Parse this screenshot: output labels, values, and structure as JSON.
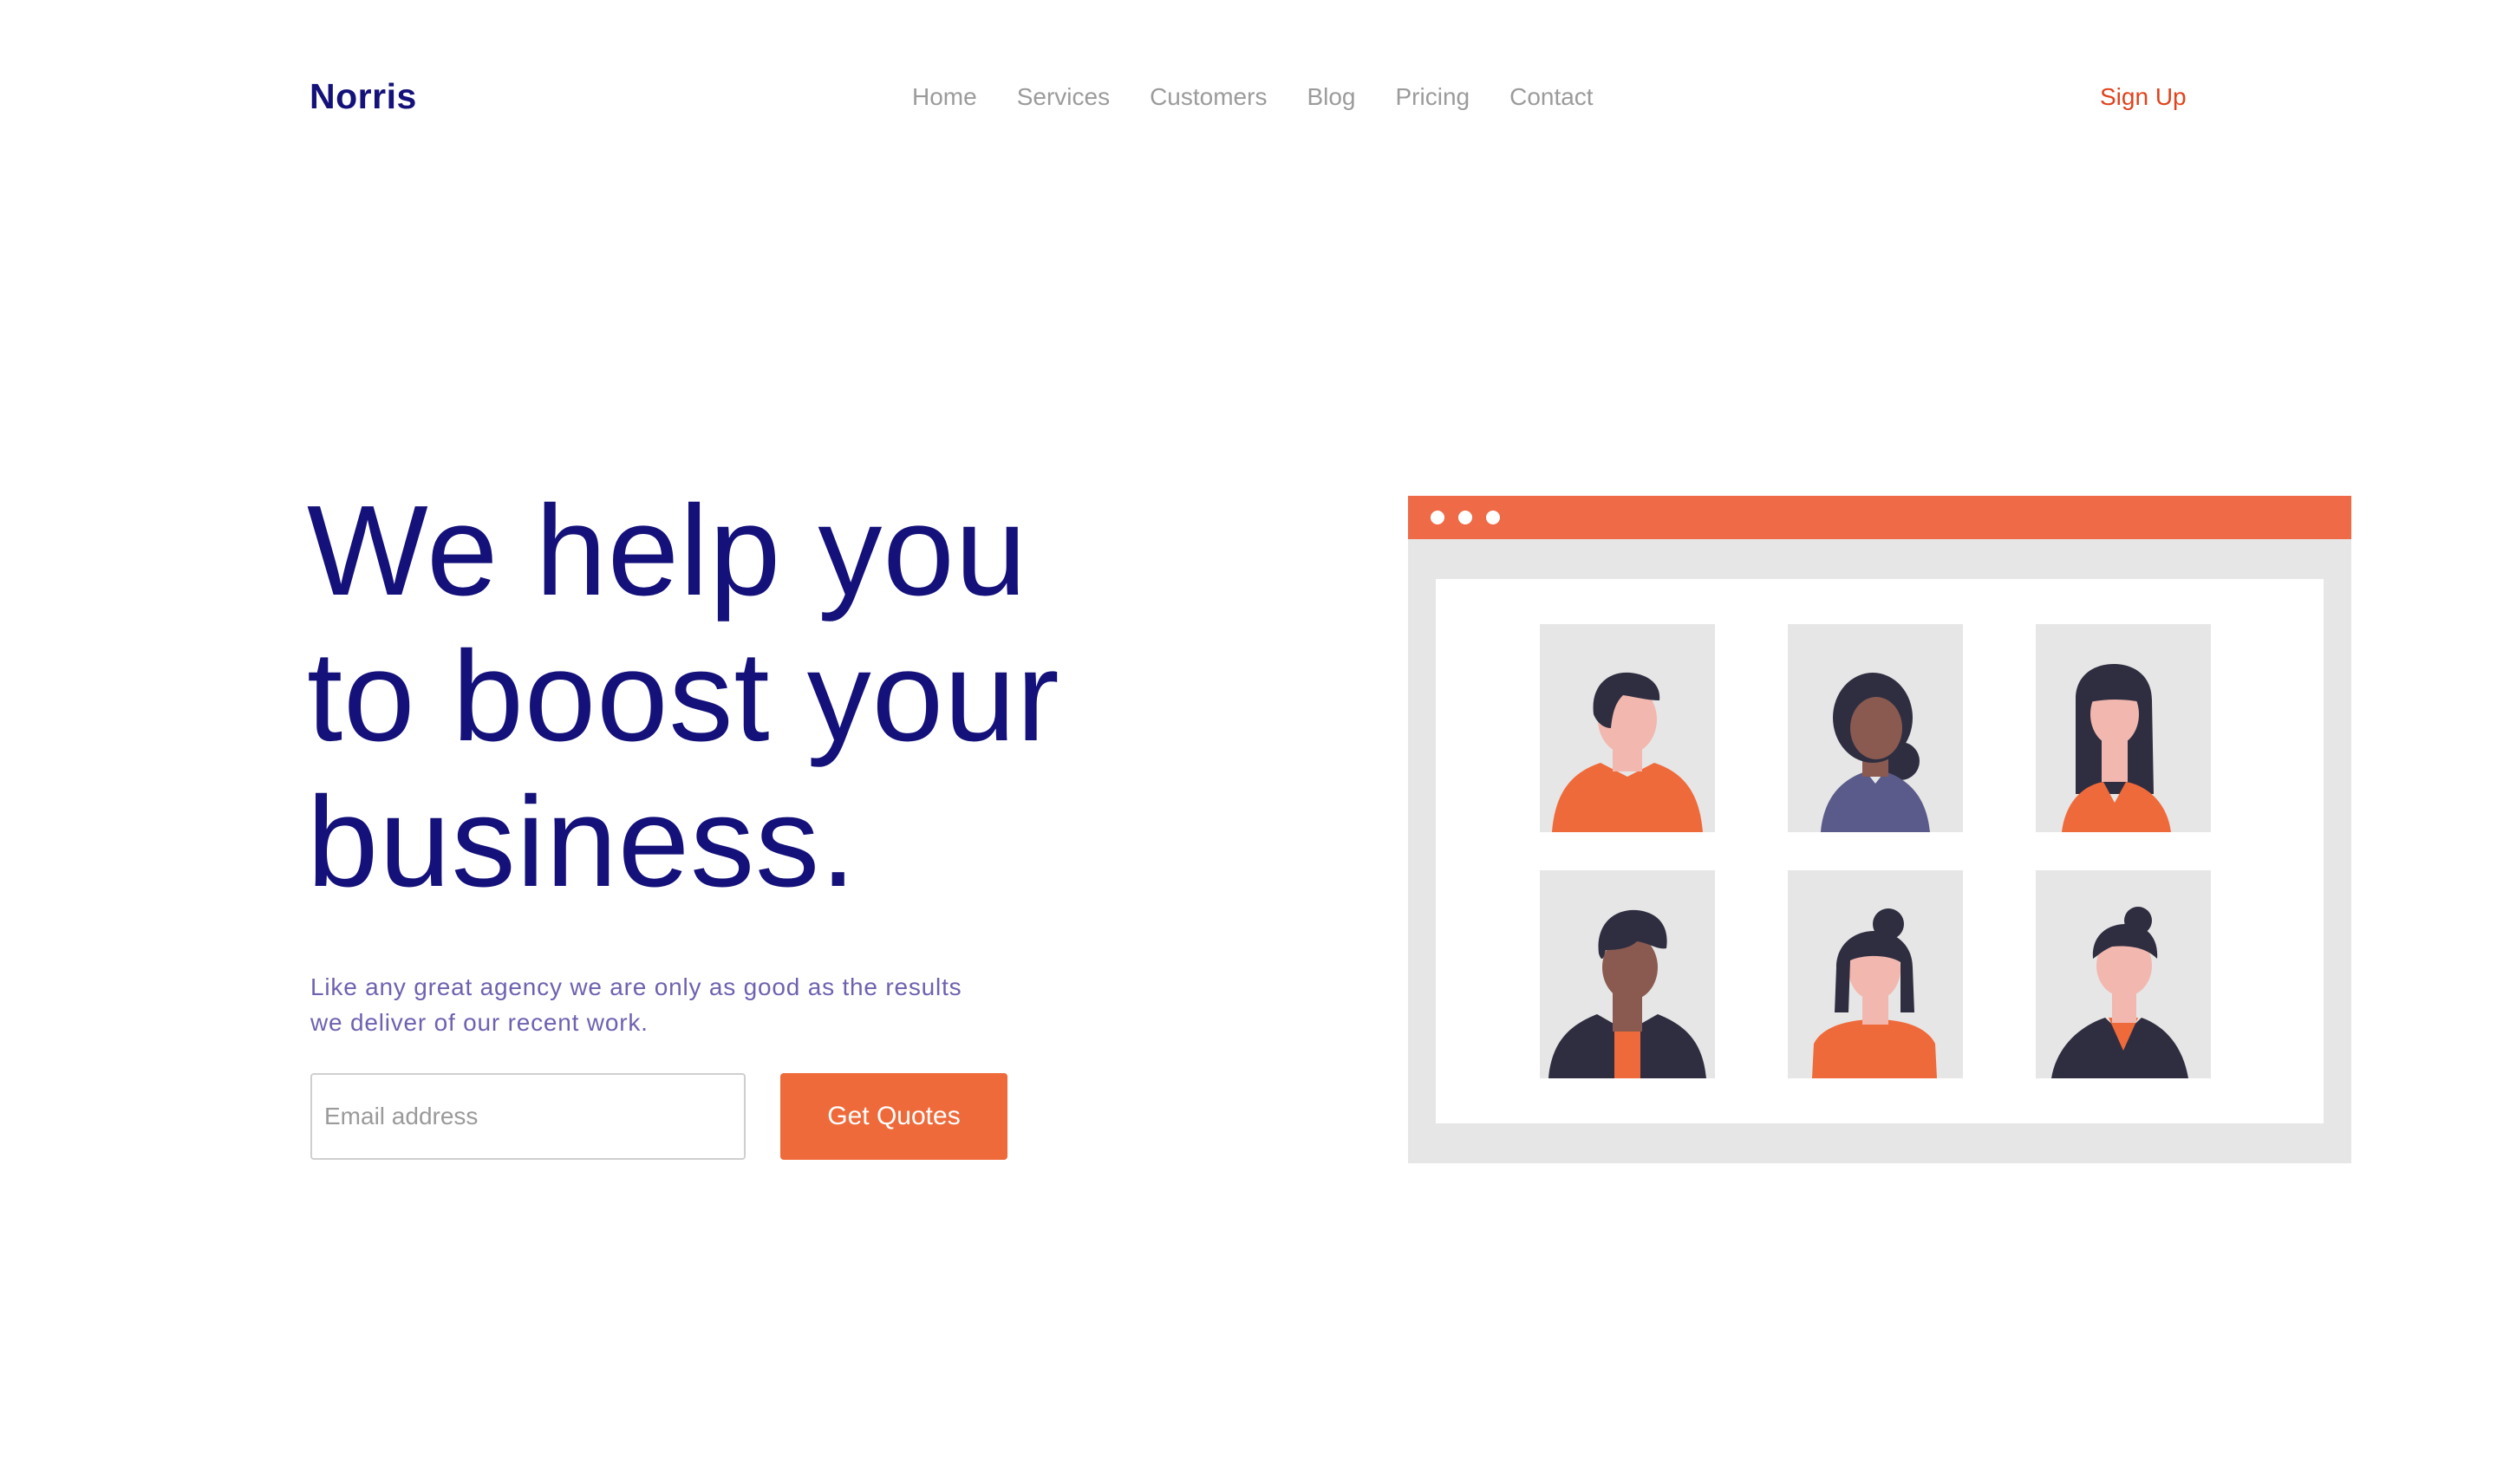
{
  "brand": {
    "name": "Norris"
  },
  "nav": {
    "items": [
      "Home",
      "Services",
      "Customers",
      "Blog",
      "Pricing",
      "Contact"
    ],
    "signup_label": "Sign Up"
  },
  "hero": {
    "headline_lines": [
      "We help you",
      "to boost your",
      "business."
    ],
    "subtitle_lines": [
      "Like any great agency we are only as good as the results",
      "we deliver of our recent work."
    ],
    "email_placeholder": "Email address",
    "cta_label": "Get Quotes"
  },
  "illustration": {
    "avatars": [
      "person-1",
      "person-2",
      "person-3",
      "person-4",
      "person-5",
      "person-6"
    ]
  },
  "colors": {
    "brand_navy": "#14117a",
    "accent_orange": "#ef6a3a",
    "signup_red": "#e0431d",
    "subtitle_purple": "#6e62b0",
    "nav_gray": "#9b9b9b"
  }
}
